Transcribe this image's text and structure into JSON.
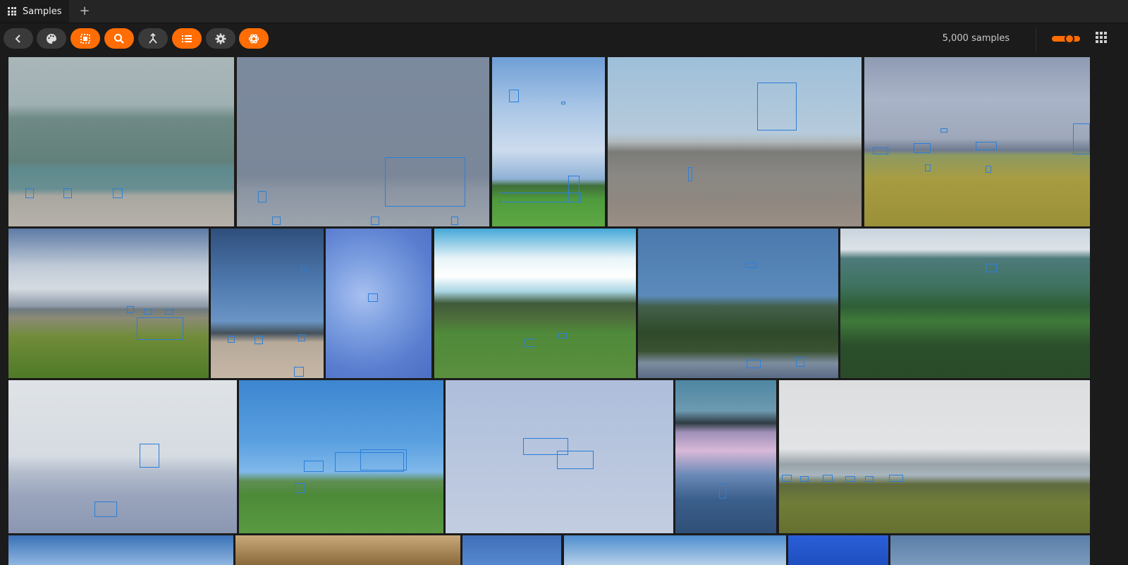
{
  "tab": {
    "label": "Samples",
    "add_label": "+"
  },
  "toolbar": {
    "buttons": [
      {
        "name": "back-button",
        "icon": "chevron-left-icon",
        "active": false
      },
      {
        "name": "color-button",
        "icon": "palette-icon",
        "active": false
      },
      {
        "name": "selection-button",
        "icon": "select-icon",
        "active": true
      },
      {
        "name": "search-button",
        "icon": "search-icon",
        "active": true
      },
      {
        "name": "merge-button",
        "icon": "merge-icon",
        "active": false
      },
      {
        "name": "list-button",
        "icon": "list-icon",
        "active": true
      },
      {
        "name": "settings-button",
        "icon": "gear-icon",
        "active": false
      },
      {
        "name": "openai-button",
        "icon": "openai-icon",
        "active": true
      }
    ],
    "sample_count": "5,000 samples"
  },
  "colors": {
    "accent": "#ff6d04",
    "box": "#2b7fd8",
    "bg": "#1b1b1b"
  }
}
